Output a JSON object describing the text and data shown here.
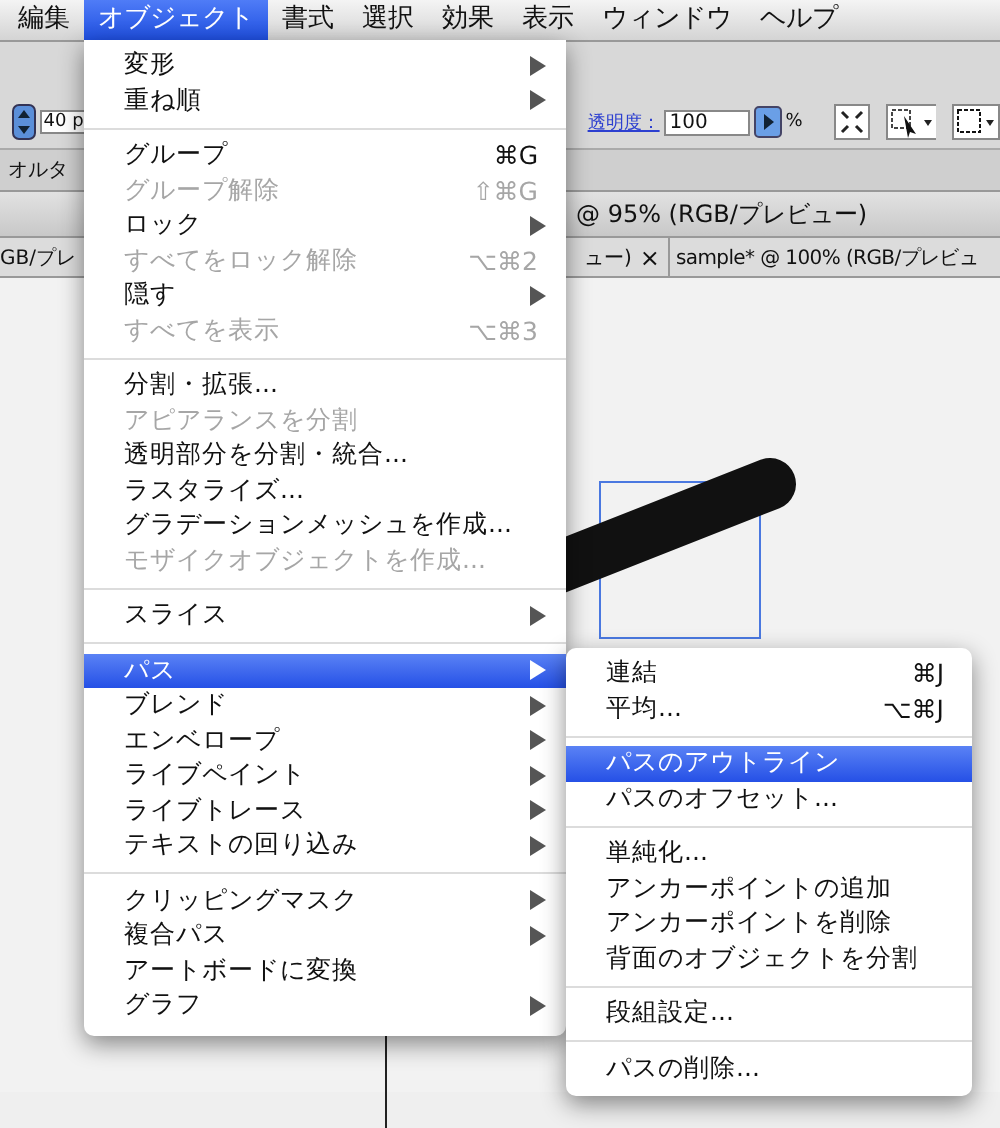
{
  "menubar": [
    {
      "label": "編集",
      "selected": false
    },
    {
      "label": "オブジェクト",
      "selected": true
    },
    {
      "label": "書式",
      "selected": false
    },
    {
      "label": "選択",
      "selected": false
    },
    {
      "label": "効果",
      "selected": false
    },
    {
      "label": "表示",
      "selected": false
    },
    {
      "label": "ウィンドウ",
      "selected": false
    },
    {
      "label": "ヘルプ",
      "selected": false
    }
  ],
  "control_bar": {
    "size_value": "40 p",
    "opacity_label": "透明度：",
    "opacity_value": "100",
    "opacity_unit": "%"
  },
  "panel_tab": "オルタ",
  "document": {
    "title": "@ 95% (RGB/プレビュー)",
    "tabs": [
      {
        "label": "GB/プレ"
      },
      {
        "label": "ュー)",
        "close": "×"
      },
      {
        "label": "sample* @ 100% (RGB/プレビュ"
      }
    ]
  },
  "menu": [
    {
      "kind": "item",
      "label": "変形",
      "submenu": true,
      "disabled": false,
      "selected": false
    },
    {
      "kind": "item",
      "label": "重ね順",
      "submenu": true,
      "disabled": false,
      "selected": false
    },
    {
      "kind": "separator"
    },
    {
      "kind": "item",
      "label": "グループ",
      "shortcut": "⌘G",
      "submenu": false,
      "disabled": false,
      "selected": false
    },
    {
      "kind": "item",
      "label": "グループ解除",
      "shortcut": "⇧⌘G",
      "submenu": false,
      "disabled": true,
      "selected": false
    },
    {
      "kind": "item",
      "label": "ロック",
      "submenu": true,
      "disabled": false,
      "selected": false
    },
    {
      "kind": "item",
      "label": "すべてをロック解除",
      "shortcut": "⌥⌘2",
      "submenu": false,
      "disabled": true,
      "selected": false
    },
    {
      "kind": "item",
      "label": "隠す",
      "submenu": true,
      "disabled": false,
      "selected": false
    },
    {
      "kind": "item",
      "label": "すべてを表示",
      "shortcut": "⌥⌘3",
      "submenu": false,
      "disabled": true,
      "selected": false
    },
    {
      "kind": "separator"
    },
    {
      "kind": "item",
      "label": "分割・拡張...",
      "submenu": false,
      "disabled": false,
      "selected": false
    },
    {
      "kind": "item",
      "label": "アピアランスを分割",
      "submenu": false,
      "disabled": true,
      "selected": false
    },
    {
      "kind": "item",
      "label": "透明部分を分割・統合...",
      "submenu": false,
      "disabled": false,
      "selected": false
    },
    {
      "kind": "item",
      "label": "ラスタライズ...",
      "submenu": false,
      "disabled": false,
      "selected": false
    },
    {
      "kind": "item",
      "label": "グラデーションメッシュを作成...",
      "submenu": false,
      "disabled": false,
      "selected": false
    },
    {
      "kind": "item",
      "label": "モザイクオブジェクトを作成...",
      "submenu": false,
      "disabled": true,
      "selected": false
    },
    {
      "kind": "separator"
    },
    {
      "kind": "item",
      "label": "スライス",
      "submenu": true,
      "disabled": false,
      "selected": false
    },
    {
      "kind": "separator"
    },
    {
      "kind": "item",
      "label": "パス",
      "submenu": true,
      "disabled": false,
      "selected": true
    },
    {
      "kind": "item",
      "label": "ブレンド",
      "submenu": true,
      "disabled": false,
      "selected": false
    },
    {
      "kind": "item",
      "label": "エンベロープ",
      "submenu": true,
      "disabled": false,
      "selected": false
    },
    {
      "kind": "item",
      "label": "ライブペイント",
      "submenu": true,
      "disabled": false,
      "selected": false
    },
    {
      "kind": "item",
      "label": "ライブトレース",
      "submenu": true,
      "disabled": false,
      "selected": false
    },
    {
      "kind": "item",
      "label": "テキストの回り込み",
      "submenu": true,
      "disabled": false,
      "selected": false
    },
    {
      "kind": "separator"
    },
    {
      "kind": "item",
      "label": "クリッピングマスク",
      "submenu": true,
      "disabled": false,
      "selected": false
    },
    {
      "kind": "item",
      "label": "複合パス",
      "submenu": true,
      "disabled": false,
      "selected": false
    },
    {
      "kind": "item",
      "label": "アートボードに変換",
      "submenu": false,
      "disabled": false,
      "selected": false
    },
    {
      "kind": "item",
      "label": "グラフ",
      "submenu": true,
      "disabled": false,
      "selected": false
    }
  ],
  "submenu": [
    {
      "kind": "item",
      "label": "連結",
      "shortcut": "⌘J",
      "selected": false
    },
    {
      "kind": "item",
      "label": "平均...",
      "shortcut": "⌥⌘J",
      "selected": false
    },
    {
      "kind": "separator"
    },
    {
      "kind": "item",
      "label": "パスのアウトライン",
      "selected": true
    },
    {
      "kind": "item",
      "label": "パスのオフセット...",
      "selected": false
    },
    {
      "kind": "separator"
    },
    {
      "kind": "item",
      "label": "単純化...",
      "selected": false
    },
    {
      "kind": "item",
      "label": "アンカーポイントの追加",
      "selected": false
    },
    {
      "kind": "item",
      "label": "アンカーポイントを削除",
      "selected": false
    },
    {
      "kind": "item",
      "label": "背面のオブジェクトを分割",
      "selected": false
    },
    {
      "kind": "separator"
    },
    {
      "kind": "item",
      "label": "段組設定...",
      "selected": false
    },
    {
      "kind": "separator"
    },
    {
      "kind": "item",
      "label": "パスの削除...",
      "selected": false
    }
  ]
}
